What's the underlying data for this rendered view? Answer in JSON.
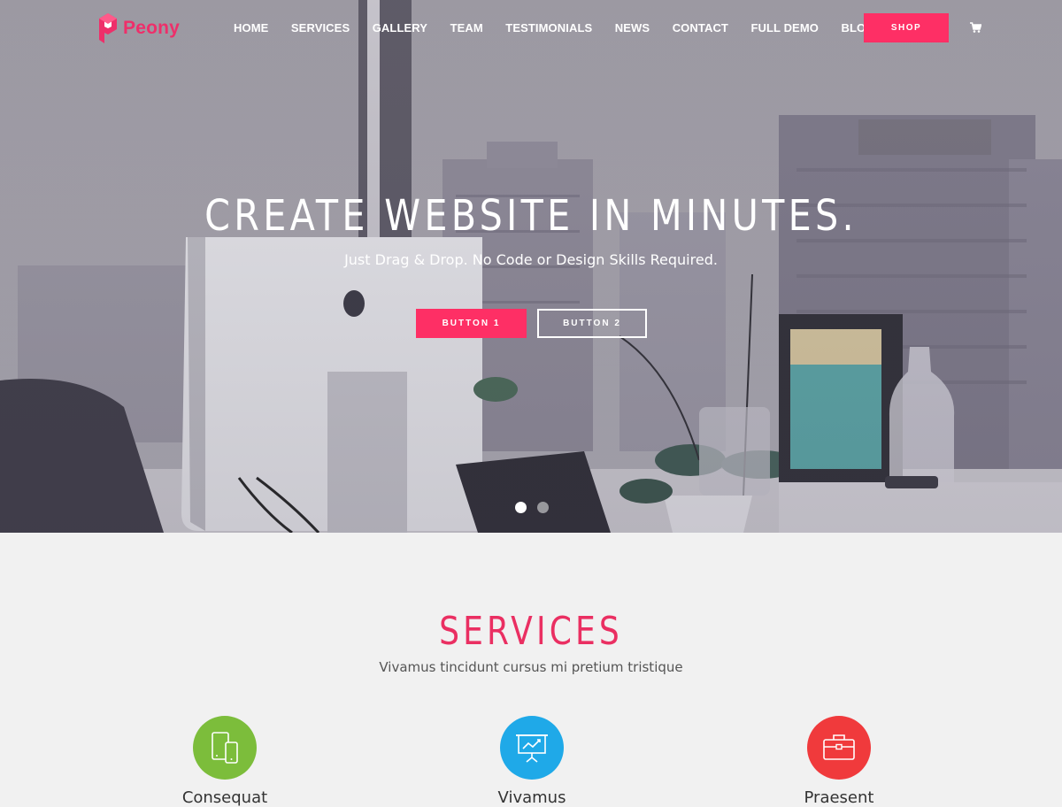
{
  "brand": {
    "name": "Peony",
    "color": "#ee2f6a"
  },
  "nav": {
    "items": [
      {
        "label": "HOME"
      },
      {
        "label": "SERVICES"
      },
      {
        "label": "GALLERY"
      },
      {
        "label": "TEAM"
      },
      {
        "label": "TESTIMONIALS"
      },
      {
        "label": "NEWS"
      },
      {
        "label": "CONTACT"
      },
      {
        "label": "FULL DEMO"
      },
      {
        "label": "BLOG"
      }
    ],
    "shop_label": "SHOP",
    "cart_icon": "cart-icon"
  },
  "hero": {
    "title": "CREATE WEBSITE IN MINUTES.",
    "subtitle": "Just Drag & Drop. No Code or Design Skills Required.",
    "button1": "BUTTON 1",
    "button2": "BUTTON 2",
    "slides": {
      "count": 2,
      "active": 1
    }
  },
  "services": {
    "title": "SERVICES",
    "subtitle": "Vivamus tincidunt cursus mi pretium tristique",
    "items": [
      {
        "label": "Consequat",
        "icon": "devices-icon",
        "color": "#7cbd3b"
      },
      {
        "label": "Vivamus",
        "icon": "presentation-chart-icon",
        "color": "#1fa9e8"
      },
      {
        "label": "Praesent",
        "icon": "briefcase-icon",
        "color": "#f03a3c"
      }
    ]
  },
  "colors": {
    "accent": "#fe2f65",
    "services_title": "#ea2f62"
  }
}
